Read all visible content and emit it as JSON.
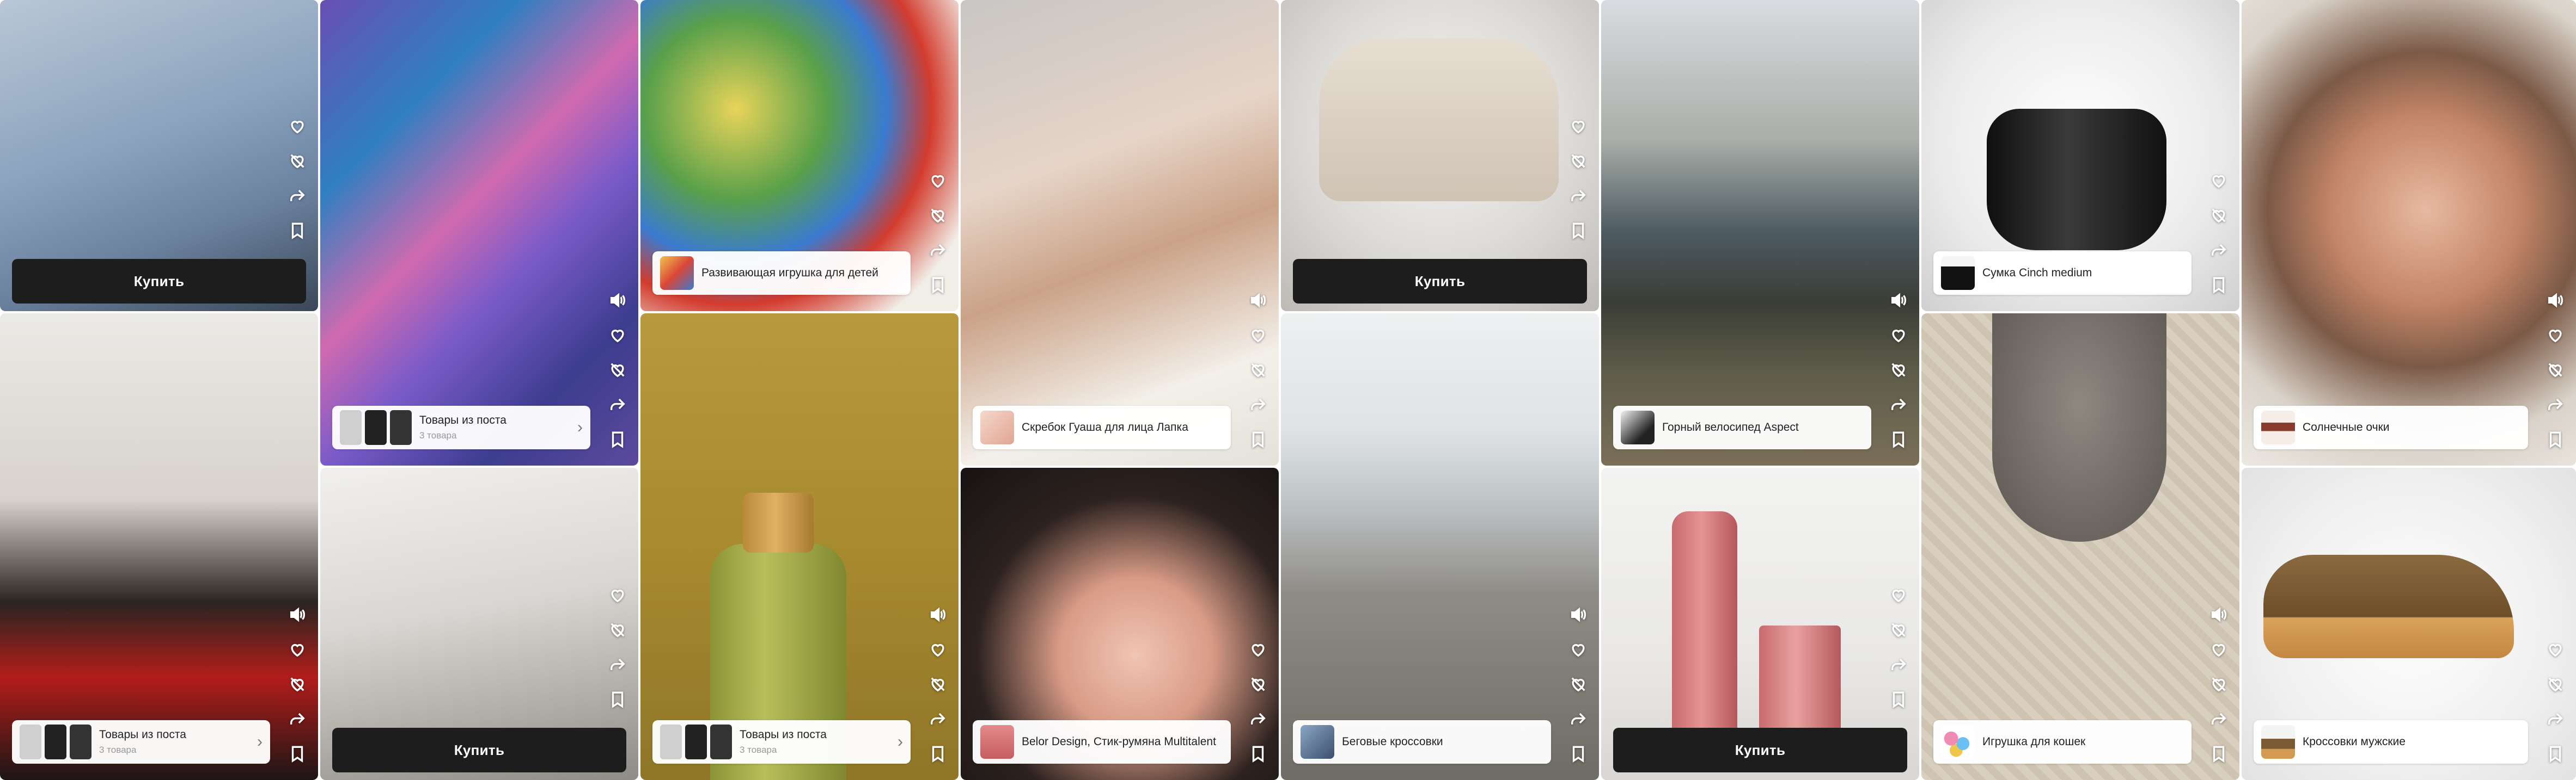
{
  "colors": {
    "buy_button": "#1d1d1d",
    "card_label_bg": "#ffffff",
    "icon": "#ffffff"
  },
  "rail_icons": [
    "sound-icon",
    "heart-icon",
    "dislike-icon",
    "share-icon",
    "bookmark-icon"
  ],
  "cards": [
    {
      "id": "c1",
      "image": "woman in blue floral blouse, back view",
      "buy": "Купить"
    },
    {
      "id": "c2",
      "image": "woman in leather jacket and red sweater",
      "products": {
        "title": "Товары из поста",
        "count": "3 товара"
      }
    },
    {
      "id": "c3",
      "image": "person in black outfit by graffiti wall",
      "products": {
        "title": "Товары из поста",
        "count": "3 товара"
      }
    },
    {
      "id": "c4",
      "image": "white heeled pumps",
      "buy": "Купить"
    },
    {
      "id": "c5",
      "image": "colorful bead maze toy",
      "product": "Развивающая игрушка для детей"
    },
    {
      "id": "c6",
      "image": "olive green bottle",
      "products": {
        "title": "Товары из поста",
        "count": "3 товара"
      }
    },
    {
      "id": "c7",
      "image": "woman with gua sha stone",
      "product": "Скребок Гуаша для лица Лапка"
    },
    {
      "id": "c8",
      "image": "woman with curly hair applying blush",
      "product": "Belor Design, Стик-румяна Multitalent"
    },
    {
      "id": "c9",
      "image": "beige armchair",
      "buy": "Купить"
    },
    {
      "id": "c10",
      "image": "running shoes on a path",
      "product": "Беговые кроссовки"
    },
    {
      "id": "c11",
      "image": "cyclist with mountain bike",
      "product": "Горный велосипед Aspect"
    },
    {
      "id": "c12",
      "image": "pink lipstick stick",
      "buy": "Купить"
    },
    {
      "id": "c13",
      "image": "black leather bucket bag",
      "product": "Сумка Cinch medium"
    },
    {
      "id": "c14",
      "image": "grey cat on rug",
      "product": "Игрушка для кошек"
    },
    {
      "id": "c15",
      "image": "woman in red sunglasses",
      "product": "Солнечные очки"
    },
    {
      "id": "c16",
      "image": "brown men's sneakers",
      "product": "Кроссовки мужские"
    }
  ]
}
